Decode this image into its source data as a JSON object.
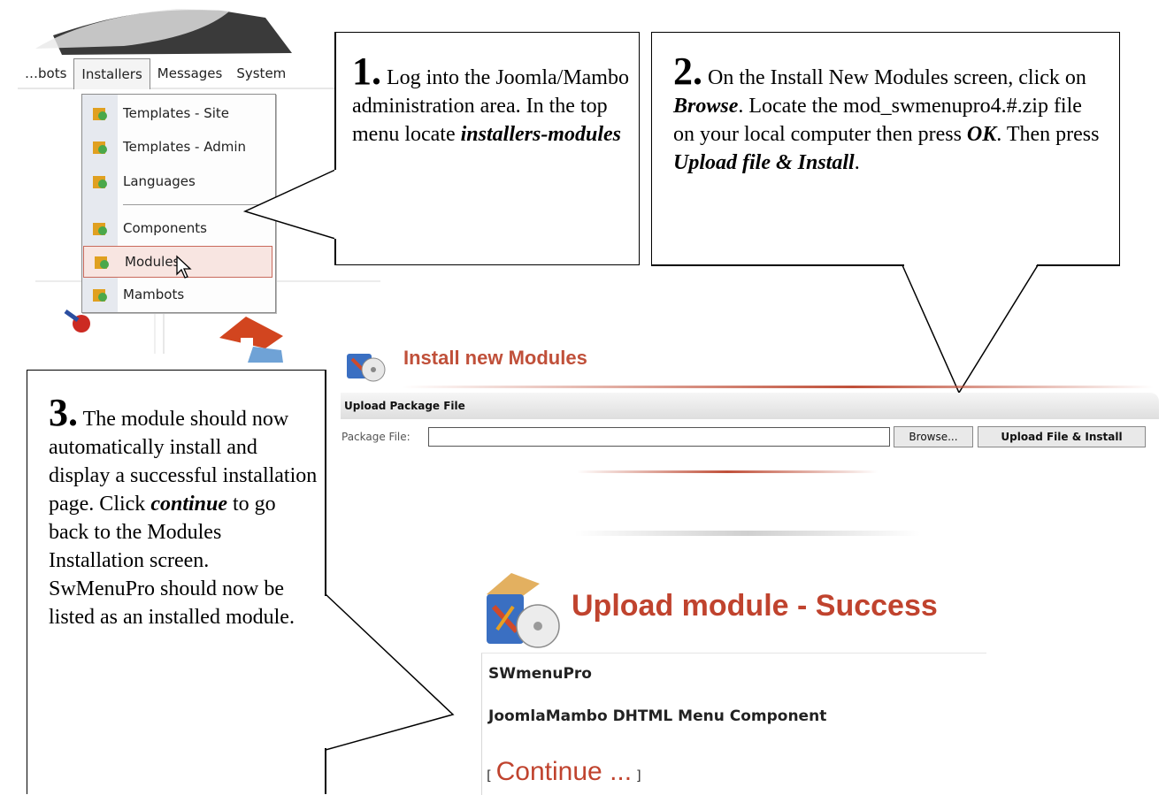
{
  "menu": {
    "bar_items": [
      "…bots",
      "Installers",
      "Messages",
      "System"
    ],
    "dropdown": {
      "items": [
        {
          "label": "Templates - Site"
        },
        {
          "label": "Templates - Admin"
        },
        {
          "label": "Languages"
        },
        {
          "label": "Components"
        },
        {
          "label": "Modules"
        },
        {
          "label": "Mambots"
        }
      ]
    }
  },
  "callouts": [
    {
      "number": "1.",
      "text_parts": [
        "Log into the Joomla/Mambo administration area.  In the top menu locate "
      ],
      "emphasis": "installers-modules"
    },
    {
      "number": "2.",
      "text_a": "On the Install New Modules screen, click on ",
      "em_a": "Browse",
      "text_b": ".  Locate the mod_swmenupro4.#.zip file on your local computer then press ",
      "em_b": "OK",
      "text_c": ".  Then press ",
      "em_c": "Upload file & Install",
      "text_d": "."
    },
    {
      "number": "3.",
      "text_a": "The module should now automatically install and display a successful installation page.  Click ",
      "em_a": "continue",
      "text_b": " to go back to the Modules Installation screen.  SwMenuPro should now be listed as an installed module."
    }
  ],
  "install_panel": {
    "title": "Install new Modules",
    "section_header": "Upload Package File",
    "package_label": "Package File:",
    "package_value": "",
    "browse_label": "Browse...",
    "upload_label": "Upload File & Install"
  },
  "success_panel": {
    "title": "Upload module - Success",
    "line1": "SWmenuPro",
    "line2": "JoomlaMambo DHTML Menu Component",
    "bracket_open": "[",
    "continue_label": "Continue ...",
    "bracket_close": "]"
  },
  "colors": {
    "accent_red": "#c0432e",
    "menu_highlight": "#f8e5e1"
  }
}
